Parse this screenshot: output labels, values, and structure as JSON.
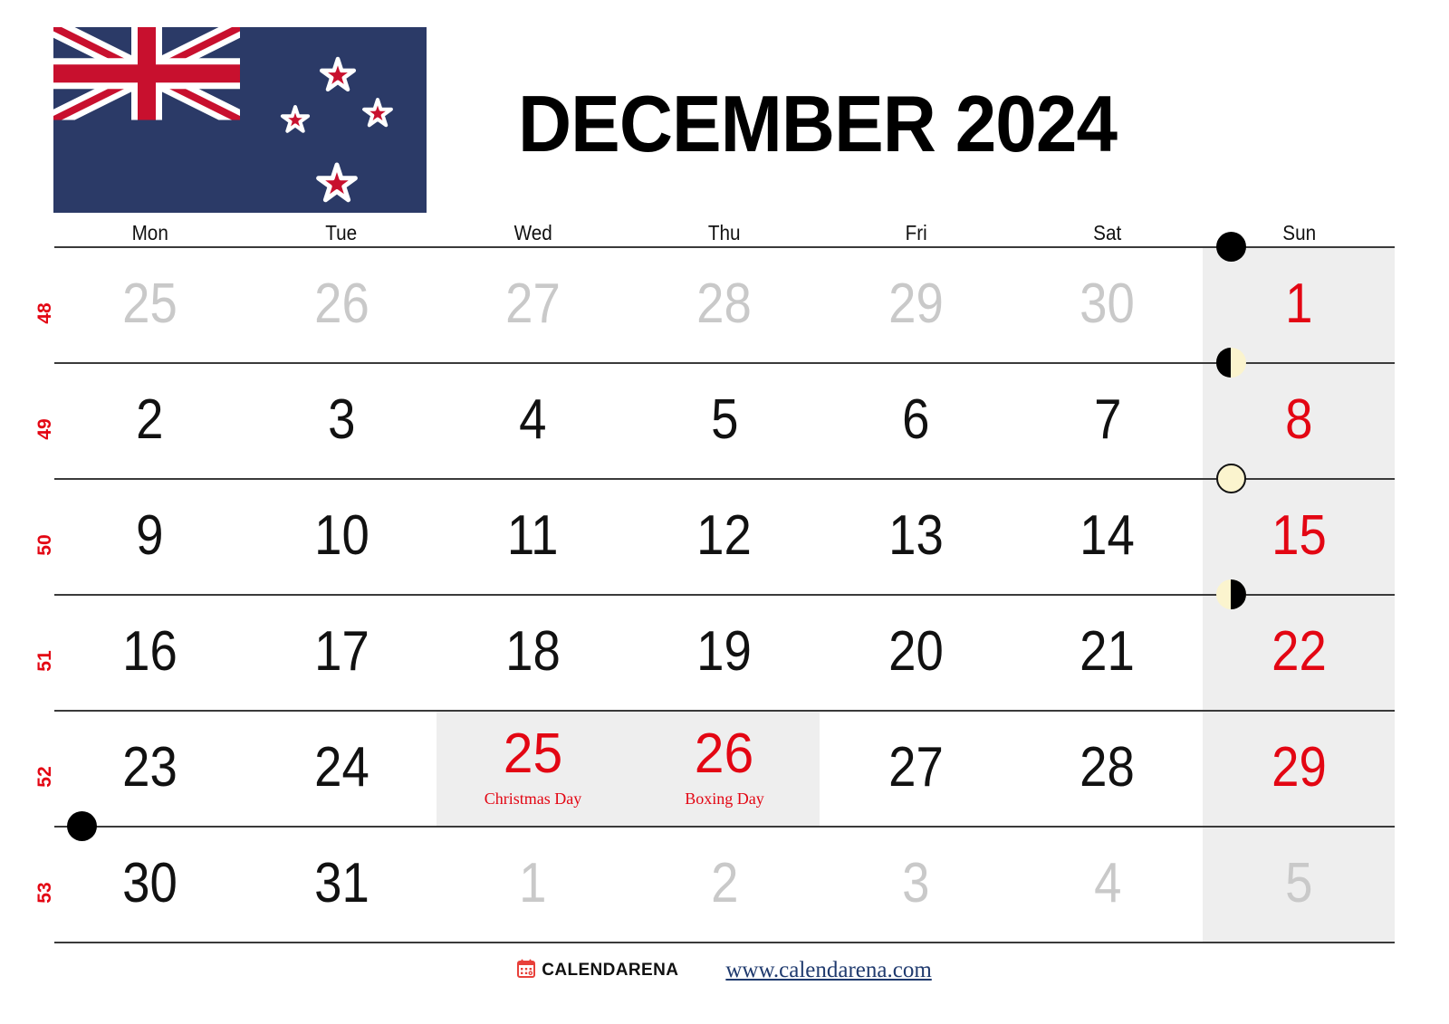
{
  "header": {
    "title": "DECEMBER 2024",
    "flag": {
      "name": "new-zealand-flag",
      "field_color": "#2B3A67",
      "cross_color": "#C8102E",
      "white_color": "#FFFFFF",
      "stars": 4
    }
  },
  "weekdays": [
    "Mon",
    "Tue",
    "Wed",
    "Thu",
    "Fri",
    "Sat",
    "Sun"
  ],
  "week_numbers": [
    "48",
    "49",
    "50",
    "51",
    "52",
    "53"
  ],
  "colors": {
    "holiday_red": "#E30613",
    "sunday_red": "#E30613",
    "other_month_gray": "#c9c9c9",
    "shade_gray": "#eeeeee",
    "rule": "#3a3a3a",
    "moon_light": "#FBF4CE",
    "moon_dark": "#000000",
    "url_navy": "#1F3A6E"
  },
  "weeks": [
    {
      "number": "48",
      "days": [
        {
          "num": "25",
          "month": "prev"
        },
        {
          "num": "26",
          "month": "prev"
        },
        {
          "num": "27",
          "month": "prev"
        },
        {
          "num": "28",
          "month": "prev"
        },
        {
          "num": "29",
          "month": "prev"
        },
        {
          "num": "30",
          "month": "prev"
        },
        {
          "num": "1",
          "month": "current",
          "sunday": true,
          "moon": "new"
        }
      ]
    },
    {
      "number": "49",
      "days": [
        {
          "num": "2",
          "month": "current"
        },
        {
          "num": "3",
          "month": "current"
        },
        {
          "num": "4",
          "month": "current"
        },
        {
          "num": "5",
          "month": "current"
        },
        {
          "num": "6",
          "month": "current"
        },
        {
          "num": "7",
          "month": "current"
        },
        {
          "num": "8",
          "month": "current",
          "sunday": true,
          "moon": "first-q"
        }
      ]
    },
    {
      "number": "50",
      "days": [
        {
          "num": "9",
          "month": "current"
        },
        {
          "num": "10",
          "month": "current"
        },
        {
          "num": "11",
          "month": "current"
        },
        {
          "num": "12",
          "month": "current"
        },
        {
          "num": "13",
          "month": "current"
        },
        {
          "num": "14",
          "month": "current"
        },
        {
          "num": "15",
          "month": "current",
          "sunday": true,
          "moon": "full"
        }
      ]
    },
    {
      "number": "51",
      "days": [
        {
          "num": "16",
          "month": "current"
        },
        {
          "num": "17",
          "month": "current"
        },
        {
          "num": "18",
          "month": "current"
        },
        {
          "num": "19",
          "month": "current"
        },
        {
          "num": "20",
          "month": "current"
        },
        {
          "num": "21",
          "month": "current"
        },
        {
          "num": "22",
          "month": "current",
          "sunday": true,
          "moon": "last-q"
        }
      ]
    },
    {
      "number": "52",
      "days": [
        {
          "num": "23",
          "month": "current"
        },
        {
          "num": "24",
          "month": "current"
        },
        {
          "num": "25",
          "month": "current",
          "holiday": "Christmas Day"
        },
        {
          "num": "26",
          "month": "current",
          "holiday": "Boxing Day"
        },
        {
          "num": "27",
          "month": "current"
        },
        {
          "num": "28",
          "month": "current"
        },
        {
          "num": "29",
          "month": "current",
          "sunday": true
        }
      ]
    },
    {
      "number": "53",
      "days": [
        {
          "num": "30",
          "month": "current",
          "moon": "new"
        },
        {
          "num": "31",
          "month": "current"
        },
        {
          "num": "1",
          "month": "next"
        },
        {
          "num": "2",
          "month": "next"
        },
        {
          "num": "3",
          "month": "next"
        },
        {
          "num": "4",
          "month": "next"
        },
        {
          "num": "5",
          "month": "next",
          "sunday": true
        }
      ]
    }
  ],
  "footer": {
    "brand_name": "CALENDARENA",
    "brand_icon": "calendar-icon",
    "url": "www.calendarena.com"
  }
}
